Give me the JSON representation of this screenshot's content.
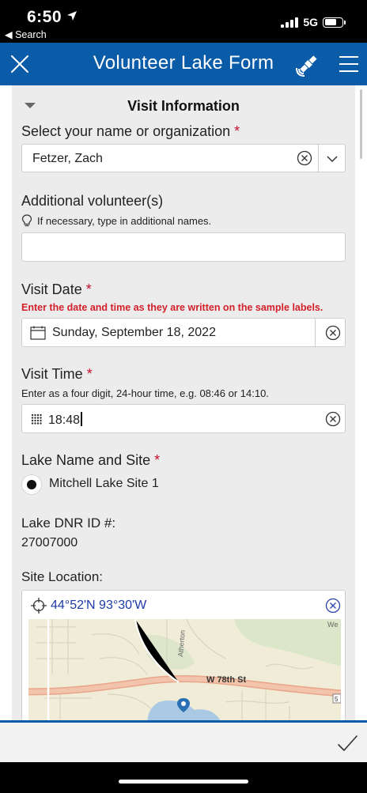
{
  "status": {
    "time": "6:50",
    "back_label": "◀ Search",
    "network": "5G"
  },
  "header": {
    "title": "Volunteer Lake Form"
  },
  "form": {
    "group_title": "Visit Information",
    "volunteer": {
      "label": "Select your name or organization",
      "required": "*",
      "value": "Fetzer, Zach"
    },
    "additional": {
      "label": "Additional volunteer(s)",
      "hint": "If necessary, type in additional names.",
      "value": ""
    },
    "visit_date": {
      "label": "Visit Date",
      "required": "*",
      "hint": "Enter the date and time as they are written on the sample labels.",
      "value": "Sunday, September 18, 2022"
    },
    "visit_time": {
      "label": "Visit Time",
      "required": "*",
      "hint": "Enter as a four digit, 24-hour time, e.g. 08:46 or 14:10.",
      "value": "18:48"
    },
    "lake_site": {
      "label": "Lake Name and Site",
      "required": "*",
      "option": "Mitchell Lake Site 1"
    },
    "lake_dnr": {
      "label": "Lake DNR ID #:",
      "value": "27007000"
    },
    "site_location": {
      "label": "Site Location:",
      "coords": "44°52'N 93°30'W"
    }
  },
  "map": {
    "street_label": "W 78th St",
    "street_vertical": "Atherton",
    "edge_label": "We",
    "route_shield": "5"
  },
  "colors": {
    "brand": "#0a5ba8",
    "required": "#c8102e",
    "link": "#1d3aa6"
  },
  "icons": [
    "close-icon",
    "satellite-icon",
    "menu-icon",
    "clear-icon",
    "chevron-down-icon",
    "lightbulb-icon",
    "calendar-icon",
    "keypad-icon",
    "crosshair-icon",
    "checkmark-icon"
  ]
}
